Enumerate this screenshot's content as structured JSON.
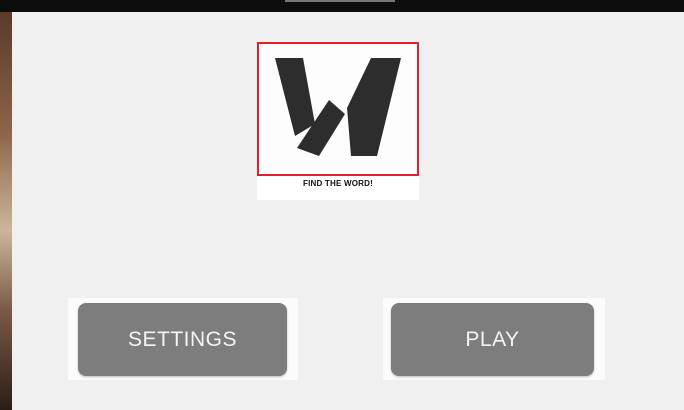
{
  "logo": {
    "icon": "w-letter-logo",
    "frame_color": "#e0202a",
    "tagline": "FIND THE WORD!"
  },
  "buttons": {
    "settings_label": "SETTINGS",
    "play_label": "PLAY"
  },
  "colors": {
    "button_bg": "#7d7d7d",
    "button_text": "#f4f4f4",
    "background": "#f0f0f0"
  }
}
